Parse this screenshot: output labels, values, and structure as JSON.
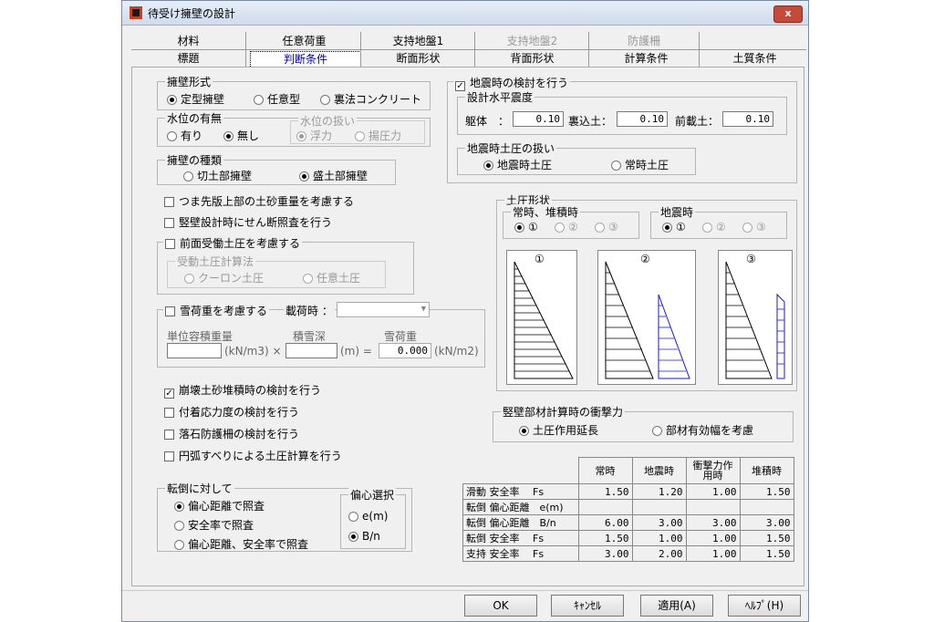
{
  "window": {
    "title": "待受け擁壁の設計",
    "close_label": "x"
  },
  "tabs": {
    "row1": [
      "材料",
      "任意荷重",
      "支持地盤1",
      "支持地盤2",
      "防護柵"
    ],
    "row2": [
      "標題",
      "判断条件",
      "断面形状",
      "背面形状",
      "計算条件",
      "土質条件"
    ]
  },
  "wall_type": {
    "label": "擁壁形式",
    "options": [
      "定型擁壁",
      "任意型",
      "裏法コンクリート"
    ],
    "selected": "定型擁壁"
  },
  "water": {
    "label": "水位の有無",
    "options": [
      "有り",
      "無し"
    ],
    "selected": "無し",
    "handling_label": "水位の扱い",
    "handling_options": [
      "浮力",
      "揚圧力"
    ],
    "handling_selected": "浮力"
  },
  "wall_kind": {
    "label": "擁壁の種類",
    "options": [
      "切土部擁壁",
      "盛土部擁壁"
    ],
    "selected": "盛土部擁壁"
  },
  "checks1": [
    {
      "label": "つま先版上部の土砂重量を考慮する",
      "checked": false
    },
    {
      "label": "竪壁設計時にせん断照査を行う",
      "checked": false
    }
  ],
  "passive": {
    "label": "前面受働土圧を考慮する",
    "checked": false,
    "calc_label": "受動土圧計算法",
    "options": [
      "クーロン土圧",
      "任意土圧"
    ]
  },
  "snow": {
    "label": "雪荷重を考慮する",
    "checked": false,
    "loading_label": "載荷時 ：",
    "unit_weight_label": "単位容積重量",
    "depth_label": "積雪深",
    "snow_load_label": "雪荷重",
    "unit1": "(kN/m3) ×",
    "unit2": "(m) =",
    "unit3": "(kN/m2)",
    "snow_load_value": "0.000"
  },
  "checks2": [
    {
      "label": "崩壊土砂堆積時の検討を行う",
      "checked": true
    },
    {
      "label": "付着応力度の検討を行う",
      "checked": false
    },
    {
      "label": "落石防護柵の検討を行う",
      "checked": false
    },
    {
      "label": "円弧すべりによる土圧計算を行う",
      "checked": false
    }
  ],
  "overturn": {
    "label": "転倒に対して",
    "options": [
      "偏心距離で照査",
      "安全率で照査",
      "偏心距離、安全率で照査"
    ],
    "selected": "偏心距離で照査",
    "ecc_label": "偏心選択",
    "ecc_options": [
      "e(m)",
      "B/n"
    ],
    "ecc_selected": "B/n"
  },
  "seismic": {
    "label": "地震時の検討を行う",
    "checked": true,
    "coef_label": "設計水平震度",
    "body_label": "躯体　：",
    "body_value": "0.10",
    "backfill_label": "裏込土：",
    "backfill_value": "0.10",
    "front_label": "前載土：",
    "front_value": "0.10",
    "pressure_label": "地震時土圧の扱い",
    "pressure_options": [
      "地震時土圧",
      "常時土圧"
    ],
    "pressure_selected": "地震時土圧"
  },
  "earth_pressure": {
    "label": "土圧形状",
    "normal_label": "常時、堆積時",
    "seismic_label": "地震時",
    "markers": [
      "①",
      "②",
      "③"
    ],
    "normal_selected": 0,
    "seismic_selected": 0
  },
  "impact": {
    "label": "竪壁部材計算時の衝撃力",
    "options": [
      "土圧作用延長",
      "部材有効幅を考慮"
    ],
    "selected": "土圧作用延長"
  },
  "table": {
    "headers": [
      "",
      "常時",
      "地震時",
      "衝撃力作用時",
      "堆積時"
    ],
    "rows": [
      {
        "label": "滑動 安全率　 Fs",
        "values": [
          "1.50",
          "1.20",
          "1.00",
          "1.50"
        ]
      },
      {
        "label": "転倒 偏心距離　e(m)",
        "values": [
          "",
          "",
          "",
          ""
        ]
      },
      {
        "label": "転倒 偏心距離　B/n",
        "values": [
          "6.00",
          "3.00",
          "3.00",
          "3.00"
        ]
      },
      {
        "label": "転倒 安全率　 Fs",
        "values": [
          "1.50",
          "1.00",
          "1.00",
          "1.50"
        ]
      },
      {
        "label": "支持 安全率　 Fs",
        "values": [
          "3.00",
          "2.00",
          "1.00",
          "1.50"
        ]
      }
    ]
  },
  "buttons": {
    "ok": "OK",
    "cancel": "ｷｬﾝｾﾙ",
    "apply": "適用(A)",
    "help": "ﾍﾙﾌﾟ(H)"
  }
}
